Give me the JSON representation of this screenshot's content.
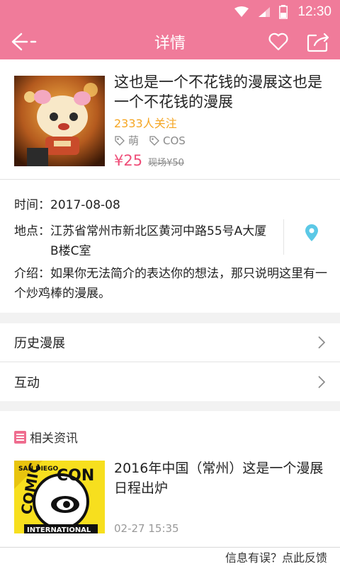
{
  "status_bar": {
    "time": "12:30"
  },
  "nav": {
    "title": "详情"
  },
  "event": {
    "title": "这也是一个不花钱的漫展这也是一个不花钱的漫展",
    "followers": "2333人关注",
    "tags": [
      "萌",
      "COS"
    ],
    "price": "¥25",
    "original_price": "现场¥50"
  },
  "details": {
    "time_label": "时间：",
    "time_value": "2017-08-08",
    "place_label": "地点：",
    "place_value": "江苏省常州市新北区黄河中路55号A大厦B楼C室",
    "intro_label": "介绍：",
    "intro_value": "如果你无法简介的表达你的想法，那只说明这里有一个炒鸡棒的漫展。"
  },
  "menu": [
    "历史漫展",
    "互动"
  ],
  "news": {
    "section_title": "相关资讯",
    "items": [
      {
        "title": "2016年中国（常州）这是一个漫展日程出炉",
        "time": "02-27  15:35"
      }
    ]
  },
  "footer": {
    "feedback": "信息有误？点此反馈"
  },
  "colors": {
    "brand": "#f07b9a",
    "price": "#ef4e79",
    "follow": "#f5a623",
    "pin": "#5bc8e6"
  }
}
